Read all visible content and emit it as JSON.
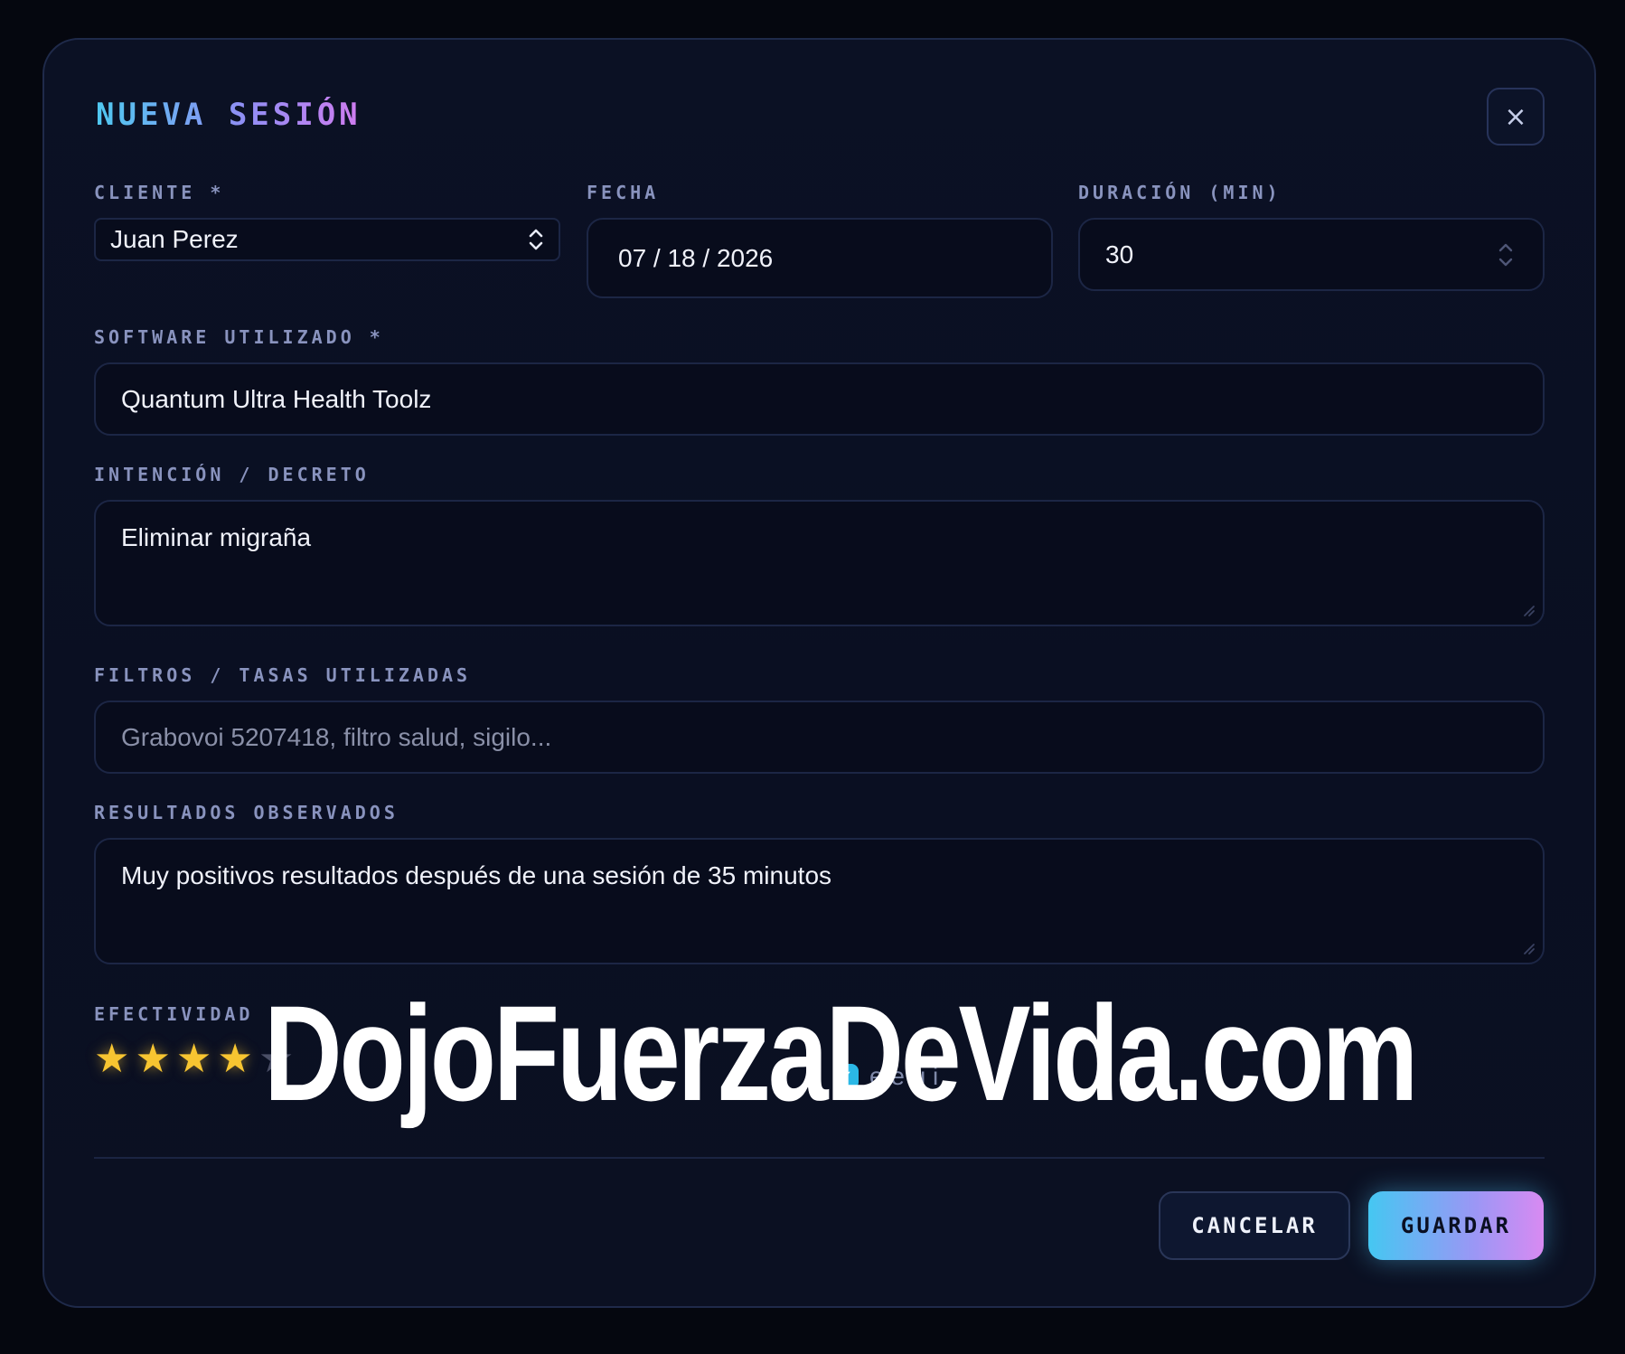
{
  "modal": {
    "title": "NUEVA SESIÓN",
    "close_icon": "close-icon",
    "close_label": "×"
  },
  "cliente": {
    "label": "CLIENTE *",
    "value": "Juan Perez"
  },
  "fecha": {
    "label": "FECHA",
    "value": "07 / 18 / 2026"
  },
  "duracion": {
    "label": "DURACIÓN (MIN)",
    "value": "30"
  },
  "software": {
    "label": "SOFTWARE UTILIZADO *",
    "value": "Quantum Ultra Health Toolz"
  },
  "intencion": {
    "label": "INTENCIÓN / DECRETO",
    "value": "Eliminar migraña"
  },
  "filtros": {
    "label": "FILTROS / TASAS UTILIZADAS",
    "placeholder": "Grabovoi 5207418, filtro salud, sigilo..."
  },
  "resultados": {
    "label": "RESULTADOS OBSERVADOS",
    "value": "Muy positivos resultados después de una sesión de 35 minutos"
  },
  "efectividad": {
    "label": "EFECTIVIDAD",
    "rating": 4,
    "max": 5,
    "star_color": "#f7c531",
    "check_partial": "e e u i"
  },
  "watermark": "DojoFuerzaDeVida.com",
  "actions": {
    "cancel_label": "CANCELAR",
    "save_label": "GUARDAR"
  },
  "colors": {
    "accent_start": "#45c7f2",
    "accent_end": "#d88af2",
    "background": "#0a0f22"
  }
}
